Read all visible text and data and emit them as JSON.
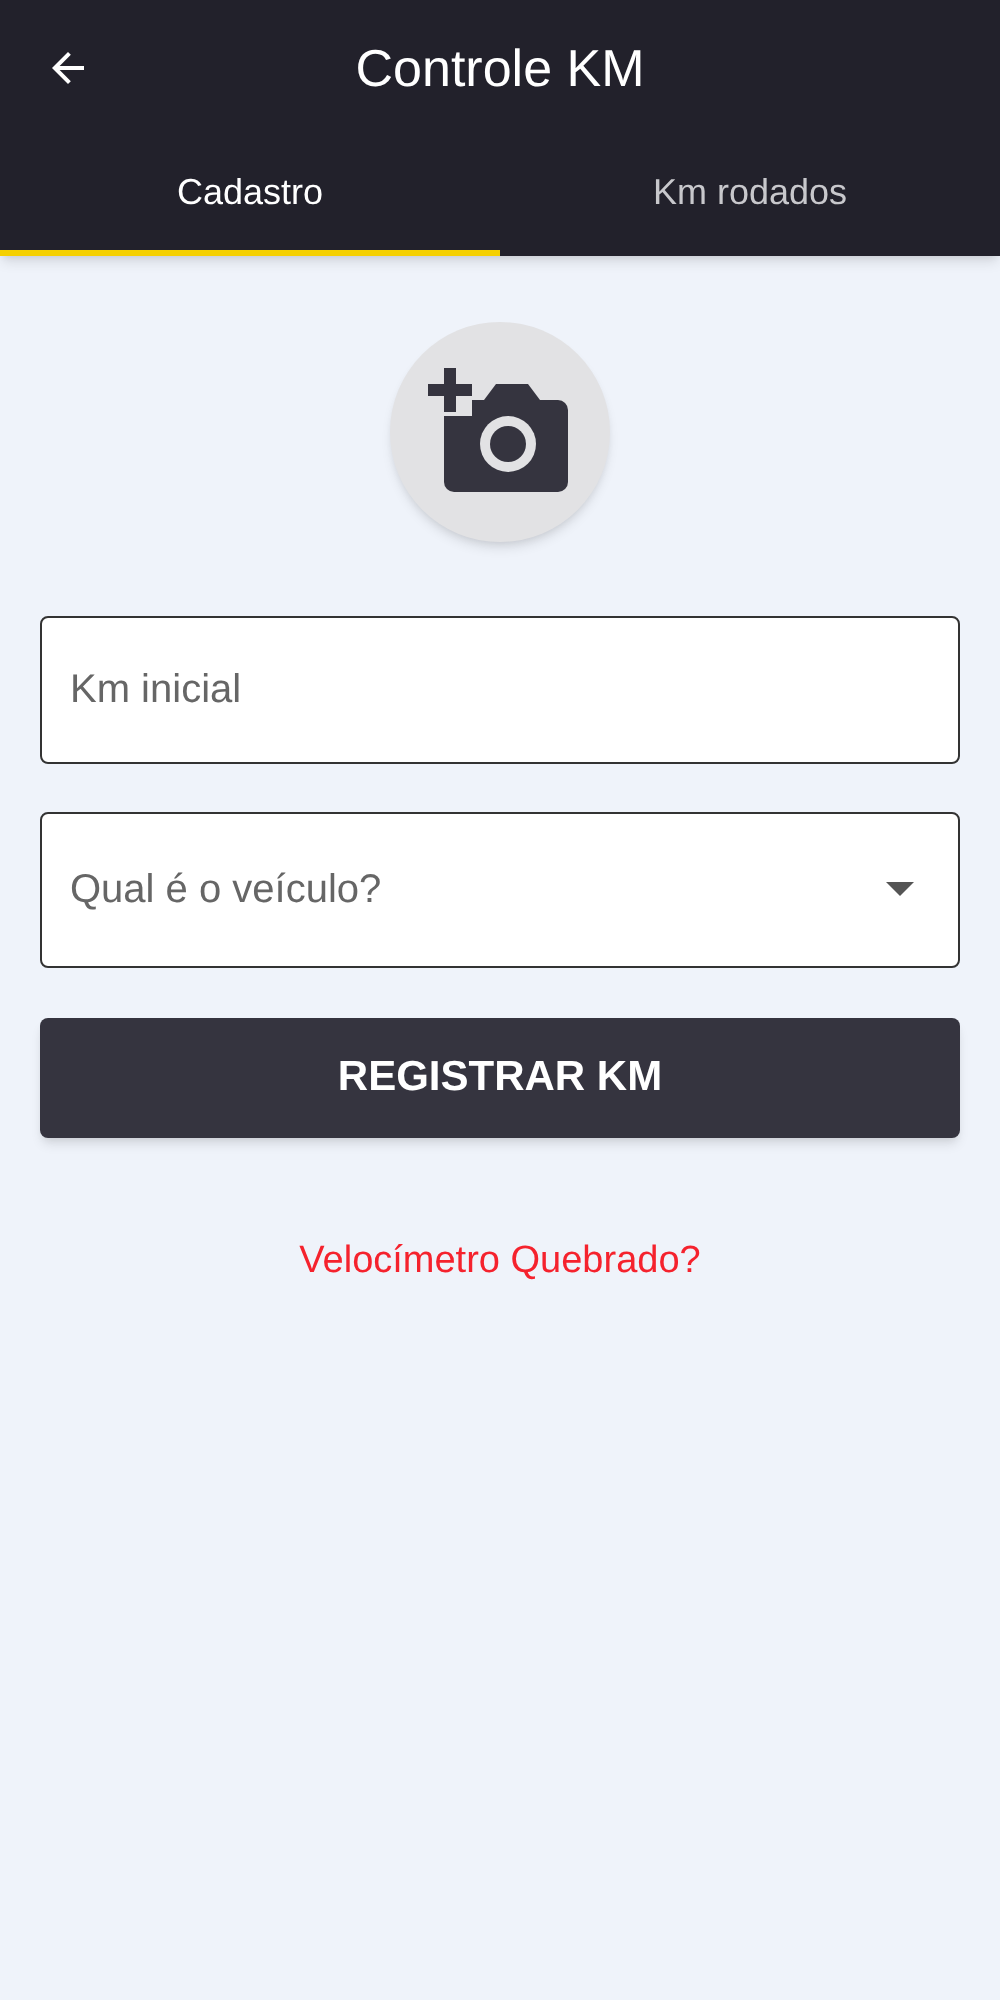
{
  "header": {
    "title": "Controle KM"
  },
  "tabs": [
    {
      "label": "Cadastro",
      "selected": true
    },
    {
      "label": "Km rodados",
      "selected": false
    }
  ],
  "form": {
    "km_field": {
      "placeholder": "Km inicial"
    },
    "vehicle_select": {
      "placeholder": "Qual é o veículo?"
    },
    "submit_button": "REGISTRAR KM",
    "broken_link": "Velocímetro Quebrado?"
  }
}
